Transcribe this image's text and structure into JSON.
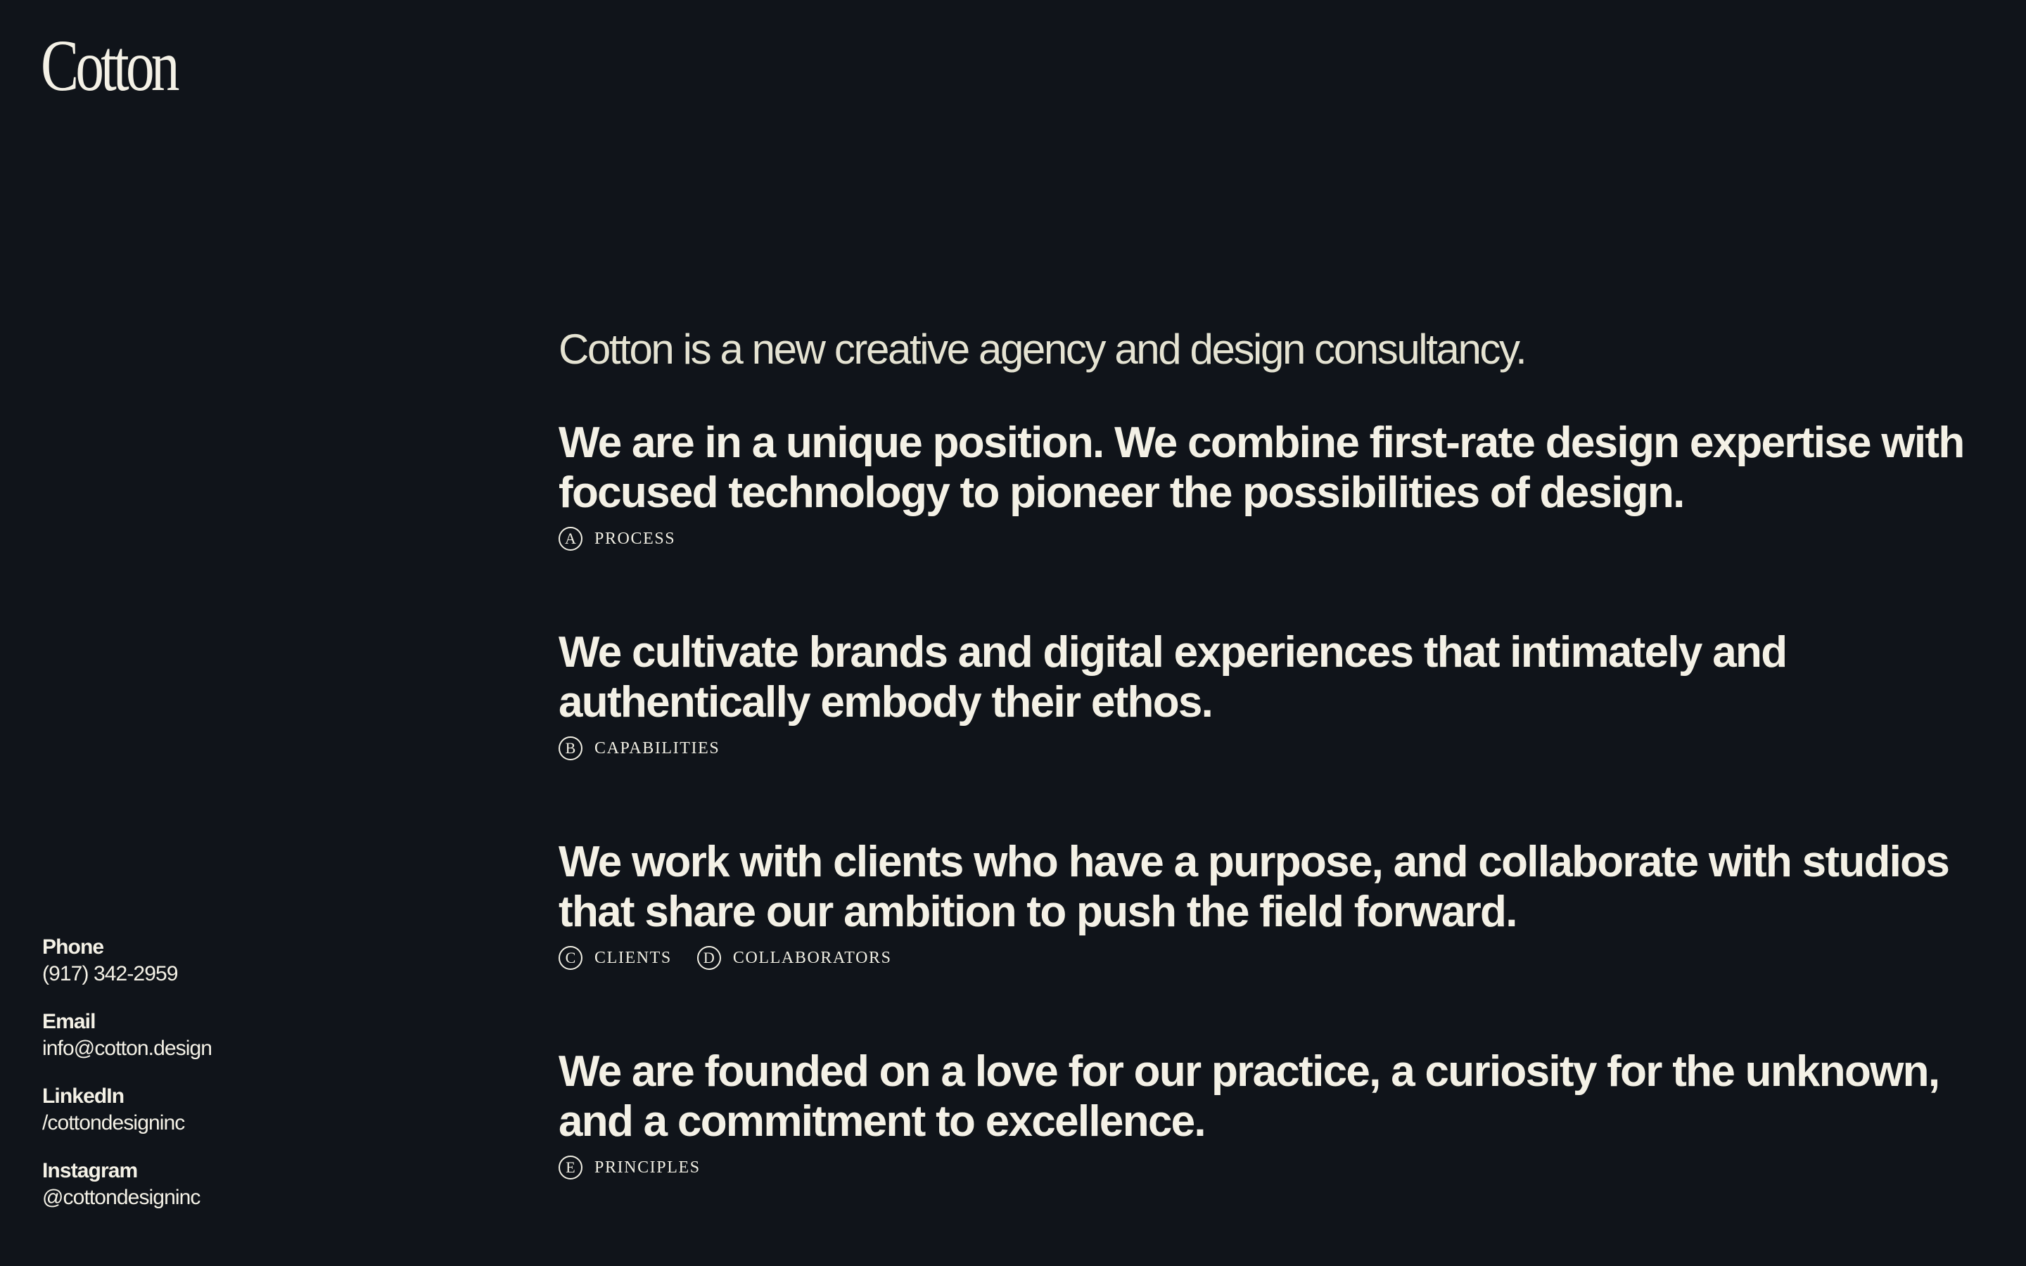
{
  "header": {
    "logo_text": "Cotton"
  },
  "main": {
    "intro": "Cotton is a new creative agency and design consultancy.",
    "sections": [
      {
        "statement": "We are in a unique position. We combine first-rate design expertise with focused technology to pioneer the possibilities of design.",
        "tags": [
          {
            "letter": "A",
            "label": "PROCESS"
          }
        ]
      },
      {
        "statement": "We cultivate brands and digital experiences that intimately and authentically embody their ethos.",
        "tags": [
          {
            "letter": "B",
            "label": "CAPABILITIES"
          }
        ]
      },
      {
        "statement": "We work with clients who have a purpose, and collaborate with studios that share our ambition to push the field forward.",
        "tags": [
          {
            "letter": "C",
            "label": "CLIENTS"
          },
          {
            "letter": "D",
            "label": "COLLABORATORS"
          }
        ]
      },
      {
        "statement": "We are founded on a love for our practice, a curiosity for the unknown, and a commitment to excellence.",
        "tags": [
          {
            "letter": "E",
            "label": "PRINCIPLES"
          }
        ]
      }
    ]
  },
  "contact": {
    "phone": {
      "label": "Phone",
      "value": "(917) 342-2959"
    },
    "email": {
      "label": "Email",
      "value": "info@cotton.design"
    },
    "linkedin": {
      "label": "LinkedIn",
      "value": "/cottondesigninc"
    },
    "instagram": {
      "label": "Instagram",
      "value": "@cottondesigninc"
    }
  },
  "colors": {
    "background": "#10141a",
    "text": "#f4f1e6"
  }
}
